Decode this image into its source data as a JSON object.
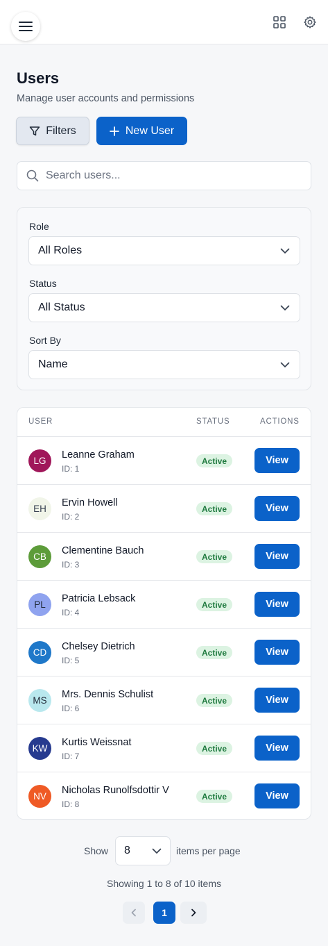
{
  "header": {
    "menu_icon": "hamburger-icon",
    "grid_icon": "grid-icon",
    "settings_icon": "gear-icon"
  },
  "page": {
    "title": "Users",
    "subtitle": "Manage user accounts and permissions"
  },
  "toolbar": {
    "filters_label": "Filters",
    "new_user_label": "New User",
    "accent_color": "#0b62c9"
  },
  "search": {
    "placeholder": "Search users...",
    "value": ""
  },
  "filters": {
    "role_label": "Role",
    "role_value": "All Roles",
    "status_label": "Status",
    "status_value": "All Status",
    "sort_label": "Sort By",
    "sort_value": "Name"
  },
  "table": {
    "headers": {
      "user": "USER",
      "status": "STATUS",
      "actions": "ACTIONS"
    },
    "view_label": "View",
    "rows": [
      {
        "initials": "LG",
        "name": "Leanne Graham",
        "id": "ID: 1",
        "status": "Active",
        "avatar_color": "#a0175a",
        "avatar_text_color": "#ffffff"
      },
      {
        "initials": "EH",
        "name": "Ervin Howell",
        "id": "ID: 2",
        "status": "Active",
        "avatar_color": "#f1f5e9",
        "avatar_text_color": "#374151"
      },
      {
        "initials": "CB",
        "name": "Clementine Bauch",
        "id": "ID: 3",
        "status": "Active",
        "avatar_color": "#5d9c3a",
        "avatar_text_color": "#ffffff"
      },
      {
        "initials": "PL",
        "name": "Patricia Lebsack",
        "id": "ID: 4",
        "status": "Active",
        "avatar_color": "#8fa3ef",
        "avatar_text_color": "#1f2937"
      },
      {
        "initials": "CD",
        "name": "Chelsey Dietrich",
        "id": "ID: 5",
        "status": "Active",
        "avatar_color": "#1f78c9",
        "avatar_text_color": "#ffffff"
      },
      {
        "initials": "MS",
        "name": "Mrs. Dennis Schulist",
        "id": "ID: 6",
        "status": "Active",
        "avatar_color": "#b9e8ee",
        "avatar_text_color": "#1f2937"
      },
      {
        "initials": "KW",
        "name": "Kurtis Weissnat",
        "id": "ID: 7",
        "status": "Active",
        "avatar_color": "#263a8f",
        "avatar_text_color": "#ffffff"
      },
      {
        "initials": "NV",
        "name": "Nicholas Runolfsdottir V",
        "id": "ID: 8",
        "status": "Active",
        "avatar_color": "#ef5a25",
        "avatar_text_color": "#ffffff"
      }
    ]
  },
  "pagination": {
    "show_label": "Show",
    "page_size": "8",
    "per_page_label": "items per page",
    "summary": "Showing 1 to 8 of 10 items",
    "current_page": "1",
    "prev_icon": "chevron-left-icon",
    "next_icon": "chevron-right-icon"
  }
}
